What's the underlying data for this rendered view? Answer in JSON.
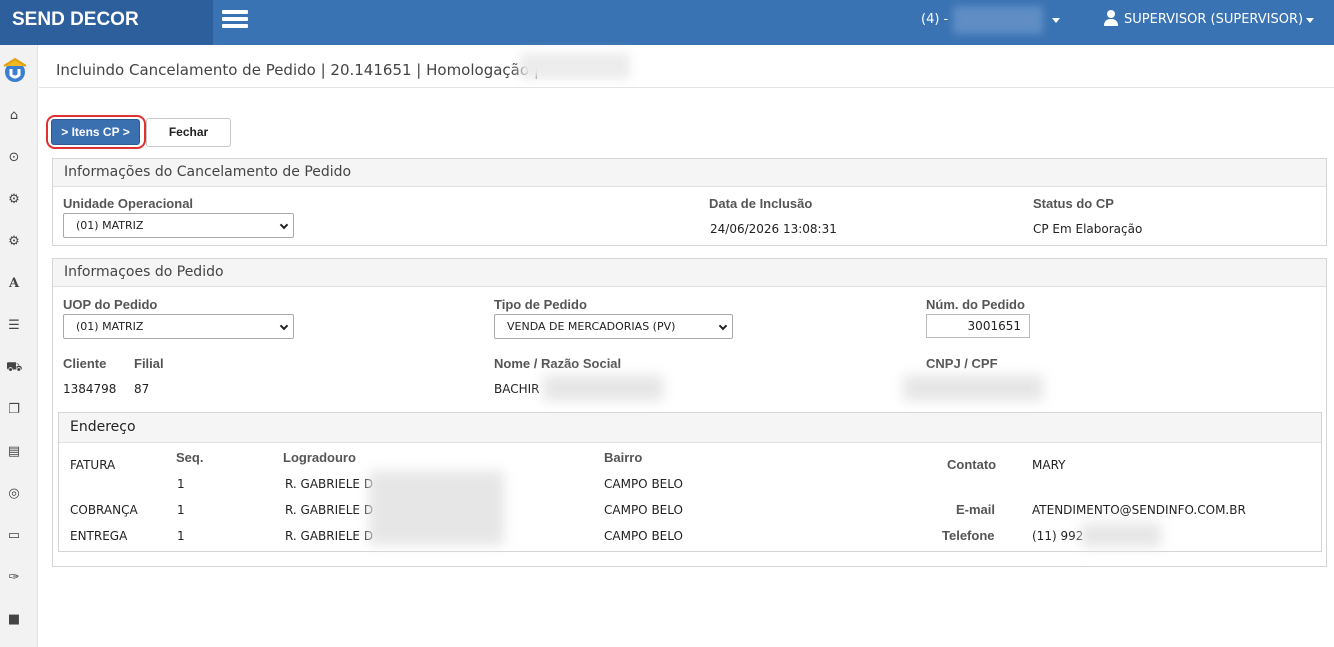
{
  "app": {
    "brand": "SEND DECOR"
  },
  "topbar": {
    "unit_label": "(4) -",
    "user_label": "SUPERVISOR (SUPERVISOR)"
  },
  "page": {
    "title": "Incluindo Cancelamento de Pedido | 20.141651 | Homologação |"
  },
  "toolbar": {
    "items_button": "> Itens CP >",
    "close_button": "Fechar"
  },
  "cancel_info": {
    "heading": "Informações do Cancelamento de Pedido",
    "unit_label": "Unidade Operacional",
    "unit_value": "(01) MATRIZ",
    "date_label": "Data de Inclusão",
    "date_value": "24/06/2026 13:08:31",
    "status_label": "Status do CP",
    "status_value": "CP Em Elaboração"
  },
  "order_info": {
    "heading": "Informaçoes do Pedido",
    "uop_label": "UOP do Pedido",
    "uop_value": "(01) MATRIZ",
    "type_label": "Tipo de Pedido",
    "type_value": "VENDA DE MERCADORIAS (PV)",
    "num_label": "Núm. do Pedido",
    "num_value": "3001651",
    "client_label": "Cliente",
    "client_value": "1384798",
    "branch_label": "Filial",
    "branch_value": "87",
    "name_label": "Nome / Razão Social",
    "name_value": "BACHIR",
    "doc_label": "CNPJ / CPF"
  },
  "address": {
    "heading": "Endereço",
    "seq_label": "Seq.",
    "street_label": "Logradouro",
    "district_label": "Bairro",
    "rows": [
      {
        "type": "FATURA",
        "seq": "1",
        "street": "R. GABRIELE D",
        "district": "CAMPO BELO"
      },
      {
        "type": "COBRANÇA",
        "seq": "1",
        "street": "R. GABRIELE D",
        "district": "CAMPO BELO"
      },
      {
        "type": "ENTREGA",
        "seq": "1",
        "street": "R. GABRIELE D",
        "district": "CAMPO BELO"
      }
    ],
    "contact_label": "Contato",
    "contact_value": "MARY",
    "email_label": "E-mail",
    "email_value": "ATENDIMENTO@SENDINFO.COM.BR",
    "phone_label": "Telefone",
    "phone_value": "(11) 992"
  },
  "sidebar": {
    "icons": [
      "logo-icon",
      "home-icon",
      "spinner-icon",
      "gears-icon",
      "gear-icon",
      "font-icon",
      "list-icon",
      "car-icon",
      "copy-icon",
      "document-icon",
      "lifebuoy-icon",
      "laptop-icon",
      "wrench-icon",
      "file-icon"
    ]
  }
}
